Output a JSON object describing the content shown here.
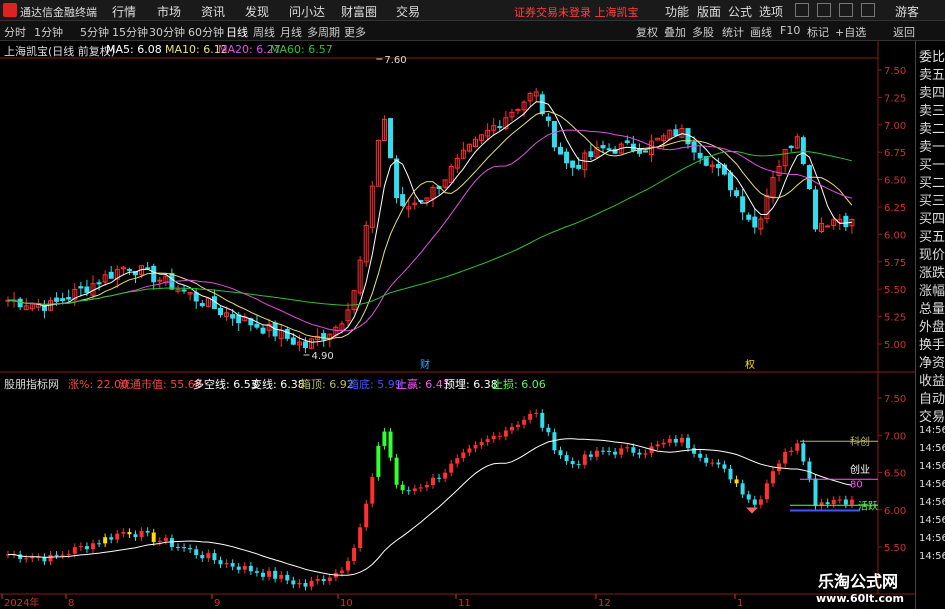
{
  "menubar": {
    "app_name": "通达信金融终端",
    "items": [
      "行情",
      "市场",
      "资讯",
      "发现",
      "问小达",
      "财富圈",
      "交易"
    ],
    "notice": "证券交易未登录  上海凯宝",
    "right_items": [
      "功能",
      "版面",
      "公式",
      "选项"
    ],
    "user": "游客"
  },
  "toolbar": {
    "periods": [
      "分时",
      "1分钟",
      "5分钟",
      "15分钟",
      "30分钟",
      "60分钟",
      "日线",
      "周线",
      "月线",
      "多周期",
      "更多"
    ],
    "active_period": "日线",
    "right_buttons": [
      "复权",
      "叠加",
      "多股",
      "统计",
      "画线",
      "F10",
      "标记",
      "+自选",
      "返回"
    ]
  },
  "main_legend": {
    "title": "上海凯宝(日线 前复权)",
    "ma5": "MA5: 6.08",
    "ma10": "MA10: 6.12",
    "ma20": "MA20: 6.27",
    "ma60": "MA60: 6.57"
  },
  "main_annotations": {
    "high": "7.60",
    "low": "4.90",
    "marker1": "财",
    "marker2": "权"
  },
  "main_axis": [
    "7.50",
    "7.25",
    "7.00",
    "6.75",
    "6.50",
    "6.25",
    "6.00",
    "5.75",
    "5.50",
    "5.25",
    "5.00"
  ],
  "sub_legend": {
    "title": "股朋指标网",
    "items": [
      {
        "label": "涨%: 22.00",
        "color": "#ff4040"
      },
      {
        "label": "流通市值: 55.68",
        "color": "#ff4040"
      },
      {
        "label": "多空线: 6.53",
        "color": "#ffffff"
      },
      {
        "label": "变线: 6.38",
        "color": "#ffffff"
      },
      {
        "label": "箱顶: 6.92",
        "color": "#bbbb55"
      },
      {
        "label": "箱底: 5.99",
        "color": "#4455ff"
      },
      {
        "label": "止赢: 6.41",
        "color": "#ff55ff"
      },
      {
        "label": "预埋: 6.38",
        "color": "#ffffff"
      },
      {
        "label": "止损: 6.06",
        "color": "#55ff55"
      }
    ]
  },
  "sub_annotations": {
    "tag1": "科创",
    "tag2": "创业",
    "tag3": "80",
    "tag4": "活跃"
  },
  "sub_axis": [
    "7.50",
    "7.00",
    "6.50",
    "6.00",
    "5.50"
  ],
  "time_axis": [
    "2024年",
    "8",
    "9",
    "10",
    "11",
    "12",
    "1"
  ],
  "side_panel": {
    "items": [
      "委比",
      "卖五",
      "卖四",
      "卖三",
      "卖二",
      "卖一",
      "买一",
      "买二",
      "买三",
      "买四",
      "买五",
      "现价",
      "涨跌",
      "涨幅",
      "总量",
      "外盘",
      "换手",
      "净资",
      "收益",
      "自动",
      "交易"
    ],
    "times": [
      "14:56",
      "14:56",
      "14:56",
      "14:56",
      "14:56",
      "14:56",
      "14:56",
      "14:56",
      "14:56"
    ]
  },
  "watermark": {
    "line1": "乐淘公式网",
    "line2": "www.60lt.com"
  },
  "colors": {
    "up": "#ff3030",
    "down": "#33ddee",
    "ma5": "#ffffff",
    "ma10": "#e8e070",
    "ma20": "#e050e0",
    "ma60": "#30c030"
  }
}
